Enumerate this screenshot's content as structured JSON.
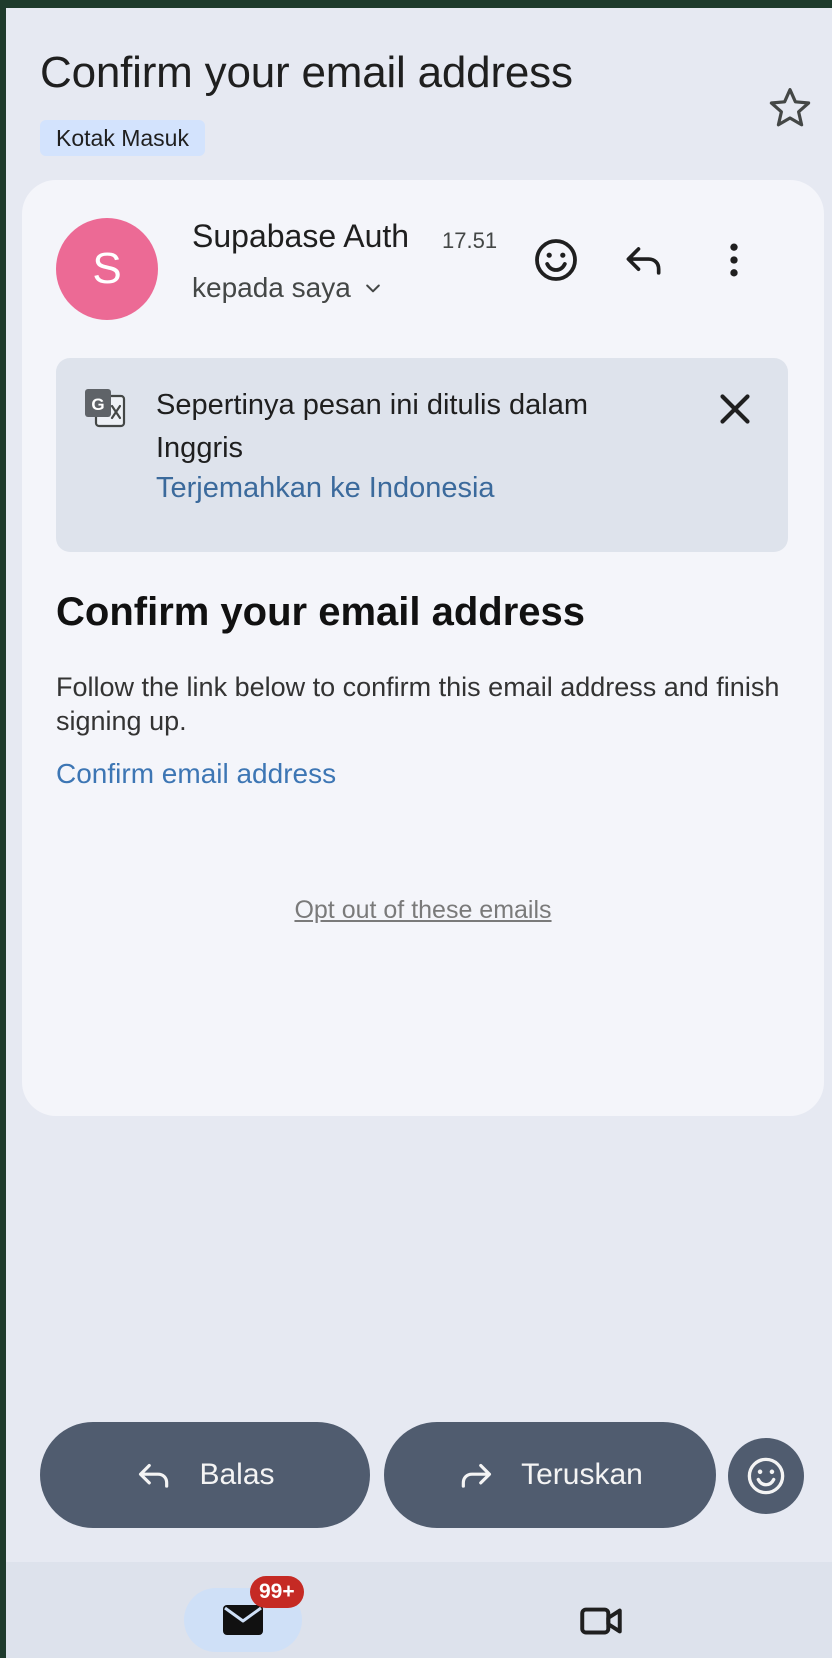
{
  "email": {
    "subject": "Confirm your email address",
    "label": "Kotak Masuk",
    "sender_initial": "S",
    "sender_name": "Supabase Auth",
    "time": "17.51",
    "recipient": "kepada saya"
  },
  "translate": {
    "message": "Sepertinya pesan ini ditulis dalam Inggris",
    "action": "Terjemahkan ke Indonesia"
  },
  "body": {
    "heading": "Confirm your email address",
    "paragraph": "Follow the link below to confirm this email address and finish signing up.",
    "link": "Confirm email address",
    "optout": "Opt out of these emails"
  },
  "actions": {
    "reply": "Balas",
    "forward": "Teruskan"
  },
  "nav": {
    "mail_badge": "99+"
  },
  "icons": [
    "star-icon",
    "emoji-icon",
    "reply-icon",
    "more-vert-icon",
    "translate-icon",
    "close-icon",
    "forward-icon",
    "mail-icon",
    "video-icon"
  ],
  "colors": {
    "avatar": "#ec6a95",
    "badge": "#c52a24",
    "link": "#3d76b4",
    "action_pill": "#505c6f"
  }
}
